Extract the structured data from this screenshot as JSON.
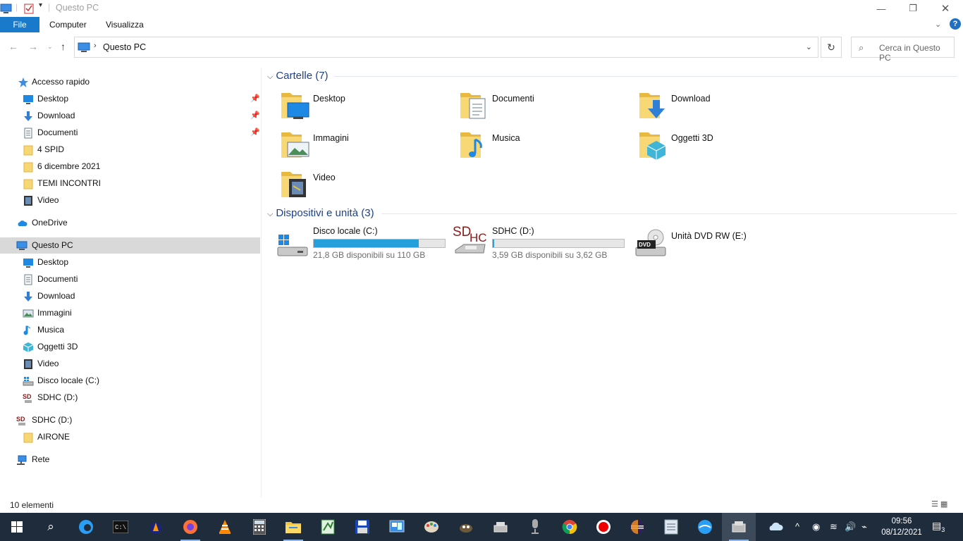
{
  "window": {
    "title": "Questo PC",
    "minimize": "—",
    "maximize": "❐",
    "close": "✕"
  },
  "ribbon": {
    "tabs": [
      "File",
      "Computer",
      "Visualizza"
    ],
    "help": "?"
  },
  "address": {
    "path": "Questo PC",
    "search_placeholder": "Cerca in Questo PC"
  },
  "sidebar": {
    "quick_access": "Accesso rapido",
    "quick_items": [
      {
        "label": "Desktop",
        "icon": "desktop-icon",
        "pinned": true
      },
      {
        "label": "Download",
        "icon": "download-icon",
        "pinned": true
      },
      {
        "label": "Documenti",
        "icon": "documents-icon",
        "pinned": true
      },
      {
        "label": "4 SPID",
        "icon": "folder-icon",
        "pinned": false
      },
      {
        "label": "6 dicembre 2021",
        "icon": "folder-icon",
        "pinned": false
      },
      {
        "label": "TEMI INCONTRI",
        "icon": "folder-icon",
        "pinned": false
      },
      {
        "label": "Video",
        "icon": "video-icon",
        "pinned": false
      }
    ],
    "onedrive": "OneDrive",
    "this_pc": "Questo PC",
    "pc_items": [
      {
        "label": "Desktop",
        "icon": "desktop-icon"
      },
      {
        "label": "Documenti",
        "icon": "documents-icon"
      },
      {
        "label": "Download",
        "icon": "download-icon"
      },
      {
        "label": "Immagini",
        "icon": "pictures-icon"
      },
      {
        "label": "Musica",
        "icon": "music-icon"
      },
      {
        "label": "Oggetti 3D",
        "icon": "3d-objects-icon"
      },
      {
        "label": "Video",
        "icon": "video-icon"
      },
      {
        "label": "Disco locale (C:)",
        "icon": "drive-icon"
      },
      {
        "label": "SDHC (D:)",
        "icon": "sdhc-icon"
      }
    ],
    "sd_root": "SDHC (D:)",
    "sd_items": [
      {
        "label": "AIRONE",
        "icon": "folder-icon"
      }
    ],
    "network": "Rete"
  },
  "content": {
    "folders_header": "Cartelle (7)",
    "folders": [
      {
        "name": "Desktop",
        "icon": "desktop-folder-icon"
      },
      {
        "name": "Documenti",
        "icon": "documents-folder-icon"
      },
      {
        "name": "Download",
        "icon": "download-folder-icon"
      },
      {
        "name": "Immagini",
        "icon": "pictures-folder-icon"
      },
      {
        "name": "Musica",
        "icon": "music-folder-icon"
      },
      {
        "name": "Oggetti 3D",
        "icon": "3d-objects-folder-icon"
      },
      {
        "name": "Video",
        "icon": "video-folder-icon"
      }
    ],
    "devices_header": "Dispositivi e unità (3)",
    "drives": [
      {
        "name": "Disco locale (C:)",
        "free": "21,8 GB disponibili su 110 GB",
        "used_fraction": 0.8,
        "icon": "windows-drive-icon"
      },
      {
        "name": "SDHC (D:)",
        "free": "3,59 GB disponibili su 3,62 GB",
        "used_fraction": 0.01,
        "icon": "sdhc-drive-icon"
      },
      {
        "name": "Unità DVD RW (E:)",
        "icon": "dvd-drive-icon"
      }
    ]
  },
  "status": {
    "count": "10 elementi"
  },
  "taskbar": {
    "time": "09:56",
    "date": "08/12/2021",
    "notifications": "3",
    "apps": [
      "start-icon",
      "search-icon",
      "edge-icon",
      "terminal-icon",
      "app-icon",
      "firefox-icon",
      "vlc-icon",
      "calculator-icon",
      "file-explorer-icon",
      "notepad-icon",
      "save-icon",
      "control-panel-icon",
      "paint-icon",
      "gimp-icon",
      "drive-manager-icon",
      "microphone-icon",
      "chrome-icon",
      "record-icon",
      "eclipse-icon",
      "notes-icon",
      "disk-icon",
      "active-window-icon"
    ]
  }
}
